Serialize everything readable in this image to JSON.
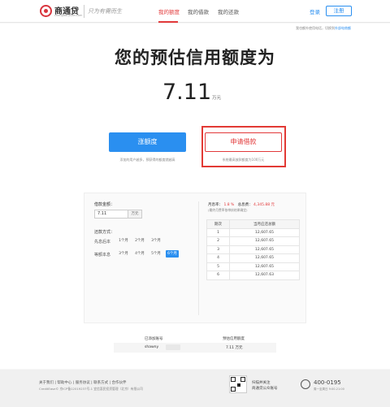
{
  "header": {
    "logo_name": "商通贷",
    "logo_url": "chengdai.yuan.com",
    "slogan": "只为有需而生",
    "nav": [
      "我的额度",
      "我的借款",
      "我的还款"
    ],
    "login": "登录",
    "register": "注册"
  },
  "hero": {
    "top_note_prefix": "我也额外使用电话，切换到",
    "top_note_link": "外部电商额",
    "title": "您的预估信用额度为",
    "amount": "7.11",
    "amount_unit": "万元",
    "raise_button": "涨额度",
    "raise_note": "添加的用户越多，预获得的额度就越高",
    "apply_button": "申请借款",
    "apply_note": "系统最高放款额度为100万元"
  },
  "calculator": {
    "amount_label": "借款金额：",
    "amount_value": "7.11",
    "amount_unit": "万元",
    "method_label": "还款方式：",
    "method_1": "先息后本",
    "method_2": "等额本息",
    "row1_options": [
      "1个月",
      "2个月",
      "3个月"
    ],
    "row2_options": [
      "3个月",
      "4个月",
      "5个月",
      "6个月"
    ],
    "selected_option": "6个月",
    "rate_label": "月息率：",
    "rate_value": "1.8 %",
    "interest_label": "总息费：",
    "interest_value": "4,345.88 元",
    "rate_note": "(最终月费率依审核结果确定)",
    "table_headers": [
      "期次",
      "当月应还总额"
    ],
    "rows": [
      [
        "1",
        "12,607.65"
      ],
      [
        "2",
        "12,607.65"
      ],
      [
        "3",
        "12,607.65"
      ],
      [
        "4",
        "12,607.65"
      ],
      [
        "5",
        "12,607.65"
      ],
      [
        "6",
        "12,607.63"
      ]
    ]
  },
  "bottom_info": {
    "account_header": "已添加账号",
    "credit_header": "预估信用额度",
    "account_value": "shawny",
    "credit_value": "7.11 万元"
  },
  "footer": {
    "links": "关于我们 | 帮助中心 | 服务协议 | 联系方式 | 合作伙伴",
    "copyright": "CreditEase© 京ICP备12019237号-1 宜信惠民投资管理（北京）有限公司",
    "follow_1": "扫描并关注",
    "follow_2": "商通贷公众账号",
    "phone": "400-0195",
    "phone_note": "周一至周日 9:00-21:00"
  }
}
